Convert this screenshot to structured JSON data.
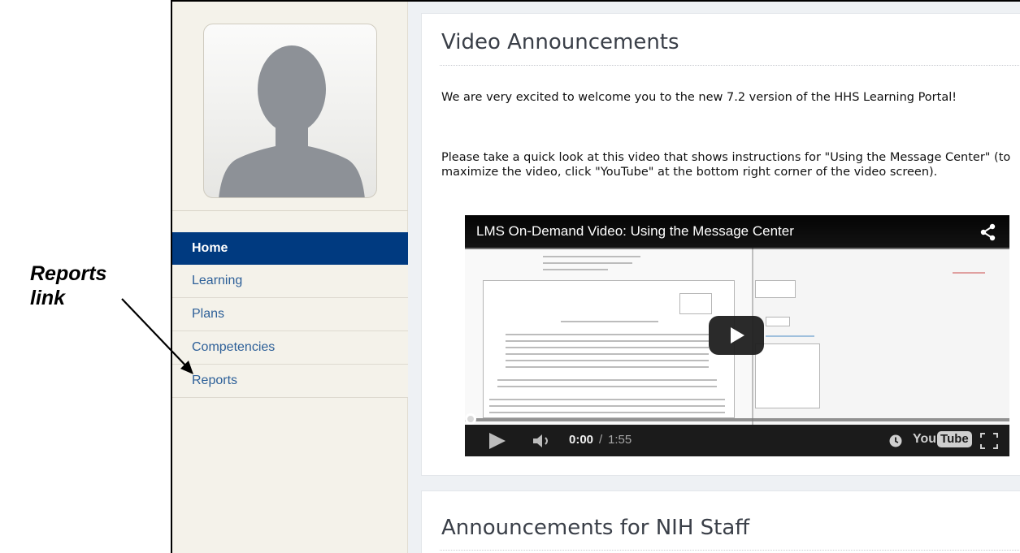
{
  "annotation": {
    "line1": "Reports",
    "line2": "link"
  },
  "sidebar": {
    "avatar_icon": "default-user-silhouette",
    "items": [
      {
        "label": "Home",
        "active": true
      },
      {
        "label": "Learning",
        "active": false
      },
      {
        "label": "Plans",
        "active": false
      },
      {
        "label": "Competencies",
        "active": false
      },
      {
        "label": "Reports",
        "active": false
      }
    ]
  },
  "main": {
    "video_card": {
      "title": "Video Announcements",
      "paragraph1": "We are very excited to welcome you to the new 7.2 version of the HHS Learning Portal!",
      "paragraph2": "Please take a quick look at this video that shows instructions for \"Using the Message Center\" (to maximize the video, click \"YouTube\" at the bottom right corner of the video screen).",
      "video": {
        "title": "LMS On-Demand Video: Using the Message Center",
        "time_current": "0:00",
        "time_separator": "/",
        "time_total": "1:55",
        "progress": 0,
        "logo_you": "You",
        "logo_tube": "Tube"
      }
    },
    "staff_card": {
      "title": "Announcements for NIH Staff"
    }
  },
  "colors": {
    "nav_active_bg": "#003a80",
    "nav_link": "#2c5f98",
    "sidebar_bg": "#f4f2ea"
  }
}
